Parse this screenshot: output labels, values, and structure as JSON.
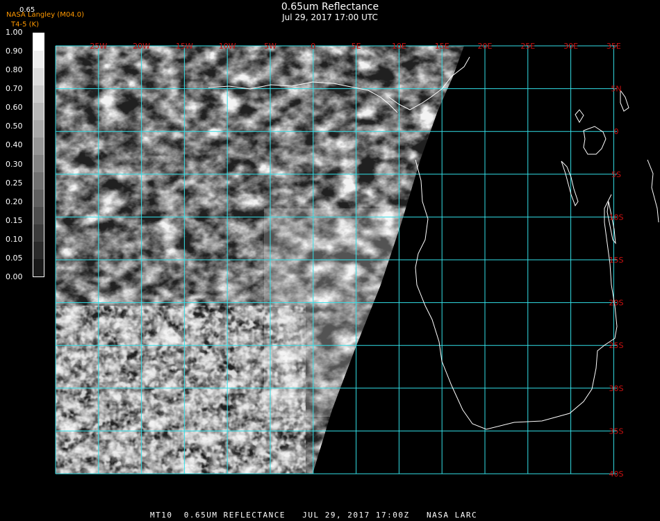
{
  "title": "0.65um Reflectance",
  "subtitle": "Jul 29, 2017 17:00 UTC",
  "credit": "NASA Langley (M04.0)",
  "credit2": "T4-5 (K)",
  "colorbar_top": "0.65",
  "colorbar_ticks": [
    "1.00",
    "0.90",
    "0.80",
    "0.70",
    "0.60",
    "0.50",
    "0.40",
    "0.30",
    "0.25",
    "0.20",
    "0.15",
    "0.10",
    "0.05",
    "0.00"
  ],
  "lon_labels": [
    "25W",
    "20W",
    "15W",
    "10W",
    "5W",
    "0",
    "5E",
    "10E",
    "15E",
    "20E",
    "25E",
    "30E",
    "35E"
  ],
  "lat_labels": [
    "5N",
    "0",
    "5S",
    "10S",
    "15S",
    "20S",
    "25S",
    "30S",
    "35S",
    "40S"
  ],
  "footer": "MT10  0.65UM REFLECTANCE   JUL 29, 2017 17:00Z   NASA LARC",
  "colors": {
    "grid": "#33e0e8",
    "tick_label": "#cc1111",
    "coast": "#ffffff",
    "credit": "#ff9900"
  }
}
